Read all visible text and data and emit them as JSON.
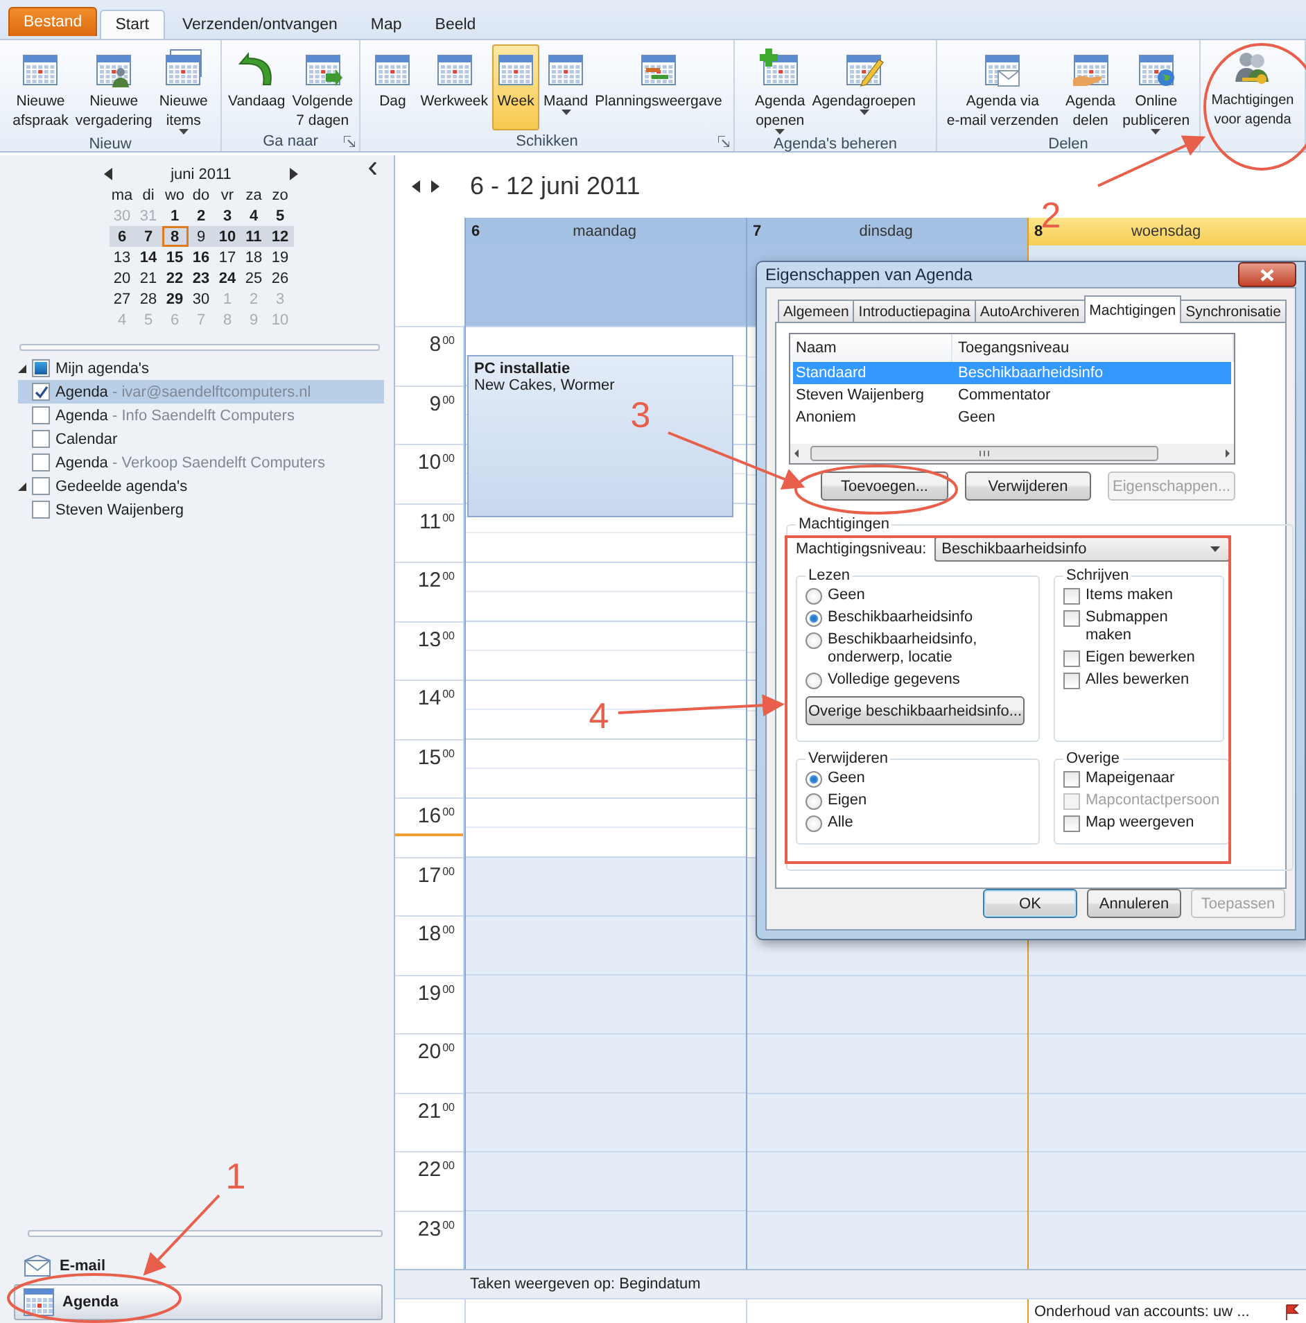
{
  "app_tabs": [
    {
      "label": "Bestand",
      "kind": "file",
      "selected": false
    },
    {
      "label": "Start",
      "kind": "tab",
      "selected": true
    },
    {
      "label": "Verzenden/ontvangen",
      "kind": "tab",
      "selected": false
    },
    {
      "label": "Map",
      "kind": "tab",
      "selected": false
    },
    {
      "label": "Beeld",
      "kind": "tab",
      "selected": false
    }
  ],
  "ribbon": [
    {
      "label": "Nieuw",
      "launcher": false,
      "buttons": [
        {
          "lines": [
            "Nieuwe",
            "afspraak"
          ],
          "dropdown": false,
          "selected": false
        },
        {
          "lines": [
            "Nieuwe",
            "vergadering"
          ],
          "dropdown": false,
          "selected": false
        },
        {
          "lines": [
            "Nieuwe",
            "items"
          ],
          "dropdown": true,
          "selected": false
        }
      ]
    },
    {
      "label": "Ga naar",
      "launcher": true,
      "buttons": [
        {
          "lines": [
            "Vandaag"
          ],
          "dropdown": false,
          "selected": false
        },
        {
          "lines": [
            "Volgende",
            "7 dagen"
          ],
          "dropdown": false,
          "selected": false
        }
      ]
    },
    {
      "label": "Schikken",
      "launcher": true,
      "buttons": [
        {
          "lines": [
            "Dag"
          ],
          "dropdown": false,
          "selected": false
        },
        {
          "lines": [
            "Werkweek"
          ],
          "dropdown": false,
          "selected": false
        },
        {
          "lines": [
            "Week"
          ],
          "dropdown": false,
          "selected": true
        },
        {
          "lines": [
            "Maand"
          ],
          "dropdown": true,
          "selected": false
        },
        {
          "lines": [
            "Planningsweergave"
          ],
          "dropdown": false,
          "selected": false
        }
      ]
    },
    {
      "label": "Agenda's beheren",
      "launcher": false,
      "buttons": [
        {
          "lines": [
            "Agenda",
            "openen"
          ],
          "dropdown": true,
          "selected": false
        },
        {
          "lines": [
            "Agendagroepen"
          ],
          "dropdown": true,
          "selected": false
        }
      ]
    },
    {
      "label": "Delen",
      "launcher": false,
      "buttons": [
        {
          "lines": [
            "Agenda via",
            "e-mail verzenden"
          ],
          "dropdown": false,
          "selected": false
        },
        {
          "lines": [
            "Agenda",
            "delen"
          ],
          "dropdown": false,
          "selected": false
        },
        {
          "lines": [
            "Online",
            "publiceren"
          ],
          "dropdown": true,
          "selected": false
        }
      ]
    },
    {
      "buttons": [
        {
          "lines": [
            "Machtigingen",
            "voor agenda"
          ],
          "dropdown": false,
          "selected": false
        }
      ]
    }
  ],
  "mini_calendar": {
    "month": "juni 2011",
    "weekdays": [
      "ma",
      "di",
      "wo",
      "do",
      "vr",
      "za",
      "zo"
    ],
    "weeks": [
      {
        "selected": false,
        "days": [
          {
            "d": "30",
            "muted": true,
            "bold": false,
            "today": false
          },
          {
            "d": "31",
            "muted": true,
            "bold": false,
            "today": false
          },
          {
            "d": "1",
            "muted": false,
            "bold": true,
            "today": false
          },
          {
            "d": "2",
            "muted": false,
            "bold": true,
            "today": false
          },
          {
            "d": "3",
            "muted": false,
            "bold": true,
            "today": false
          },
          {
            "d": "4",
            "muted": false,
            "bold": true,
            "today": false
          },
          {
            "d": "5",
            "muted": false,
            "bold": true,
            "today": false
          }
        ]
      },
      {
        "selected": true,
        "days": [
          {
            "d": "6",
            "muted": false,
            "bold": true,
            "today": false
          },
          {
            "d": "7",
            "muted": false,
            "bold": true,
            "today": false
          },
          {
            "d": "8",
            "muted": false,
            "bold": true,
            "today": true
          },
          {
            "d": "9",
            "muted": false,
            "bold": false,
            "today": false
          },
          {
            "d": "10",
            "muted": false,
            "bold": true,
            "today": false
          },
          {
            "d": "11",
            "muted": false,
            "bold": true,
            "today": false
          },
          {
            "d": "12",
            "muted": false,
            "bold": true,
            "today": false
          }
        ]
      },
      {
        "selected": false,
        "days": [
          {
            "d": "13",
            "muted": false,
            "bold": false,
            "today": false
          },
          {
            "d": "14",
            "muted": false,
            "bold": true,
            "today": false
          },
          {
            "d": "15",
            "muted": false,
            "bold": true,
            "today": false
          },
          {
            "d": "16",
            "muted": false,
            "bold": true,
            "today": false
          },
          {
            "d": "17",
            "muted": false,
            "bold": false,
            "today": false
          },
          {
            "d": "18",
            "muted": false,
            "bold": false,
            "today": false
          },
          {
            "d": "19",
            "muted": false,
            "bold": false,
            "today": false
          }
        ]
      },
      {
        "selected": false,
        "days": [
          {
            "d": "20",
            "muted": false,
            "bold": false,
            "today": false
          },
          {
            "d": "21",
            "muted": false,
            "bold": false,
            "today": false
          },
          {
            "d": "22",
            "muted": false,
            "bold": true,
            "today": false
          },
          {
            "d": "23",
            "muted": false,
            "bold": true,
            "today": false
          },
          {
            "d": "24",
            "muted": false,
            "bold": true,
            "today": false
          },
          {
            "d": "25",
            "muted": false,
            "bold": false,
            "today": false
          },
          {
            "d": "26",
            "muted": false,
            "bold": false,
            "today": false
          }
        ]
      },
      {
        "selected": false,
        "days": [
          {
            "d": "27",
            "muted": false,
            "bold": false,
            "today": false
          },
          {
            "d": "28",
            "muted": false,
            "bold": false,
            "today": false
          },
          {
            "d": "29",
            "muted": false,
            "bold": true,
            "today": false
          },
          {
            "d": "30",
            "muted": false,
            "bold": false,
            "today": false
          },
          {
            "d": "1",
            "muted": true,
            "bold": false,
            "today": false
          },
          {
            "d": "2",
            "muted": true,
            "bold": false,
            "today": false
          },
          {
            "d": "3",
            "muted": true,
            "bold": false,
            "today": false
          }
        ]
      },
      {
        "selected": false,
        "days": [
          {
            "d": "4",
            "muted": true,
            "bold": false,
            "today": false
          },
          {
            "d": "5",
            "muted": true,
            "bold": false,
            "today": false
          },
          {
            "d": "6",
            "muted": true,
            "bold": false,
            "today": false
          },
          {
            "d": "7",
            "muted": true,
            "bold": false,
            "today": false
          },
          {
            "d": "8",
            "muted": true,
            "bold": false,
            "today": false
          },
          {
            "d": "9",
            "muted": true,
            "bold": false,
            "today": false
          },
          {
            "d": "10",
            "muted": true,
            "bold": false,
            "today": false
          }
        ]
      }
    ]
  },
  "calendar_tree": [
    {
      "label": "Mijn agenda's",
      "checked": false,
      "partial": true,
      "expanded": true,
      "selected": false,
      "children": [
        {
          "label": "Agenda",
          "detail": "- ivar@saendelftcomputers.nl",
          "checked": true,
          "partial": false,
          "selected": true
        },
        {
          "label": "Agenda",
          "detail": "- Info Saendelft Computers",
          "checked": false,
          "partial": false,
          "selected": false
        },
        {
          "label": "Calendar",
          "checked": false,
          "partial": false,
          "selected": false
        },
        {
          "label": "Agenda",
          "detail": "- Verkoop Saendelft Computers",
          "checked": false,
          "partial": false,
          "selected": false
        }
      ]
    },
    {
      "label": "Gedeelde agenda's",
      "checked": false,
      "partial": false,
      "expanded": true,
      "selected": false,
      "children": [
        {
          "label": "Steven Waijenberg",
          "checked": false,
          "partial": false,
          "selected": false
        }
      ]
    }
  ],
  "nav_buttons": [
    {
      "label": "E-mail",
      "kind": "mail",
      "selected": false
    },
    {
      "label": "Agenda",
      "kind": "calendar",
      "selected": true
    }
  ],
  "calendar": {
    "date_range": "6 - 12 juni 2011",
    "days": [
      {
        "number": "6",
        "name": "maandag",
        "today": false,
        "events": [
          {
            "title": "PC installatie",
            "location": "New Cakes, Wormer"
          }
        ]
      },
      {
        "number": "7",
        "name": "dinsdag",
        "today": false
      },
      {
        "number": "8",
        "name": "woensdag",
        "today": true,
        "tasks": [
          {
            "title": "Onderhoud van accounts: uw ..."
          }
        ]
      }
    ],
    "hours": [
      {
        "label": "8$^{00}$",
        "work": true,
        "current": false
      },
      {
        "label": "9$^{00}$",
        "work": true,
        "current": false
      },
      {
        "label": "10$^{00}$",
        "work": true,
        "current": false
      },
      {
        "label": "11$^{00}$",
        "work": true,
        "current": false
      },
      {
        "label": "12$^{00}$",
        "work": true,
        "current": false
      },
      {
        "label": "13$^{00}$",
        "work": true,
        "current": false
      },
      {
        "label": "14$^{00}$",
        "work": true,
        "current": false
      },
      {
        "label": "15$^{00}$",
        "work": true,
        "current": false
      },
      {
        "label": "16$^{00}$",
        "work": true,
        "current": true
      },
      {
        "label": "17$^{00}$",
        "work": false,
        "current": false
      },
      {
        "label": "18$^{00}$",
        "work": false,
        "current": false
      },
      {
        "label": "19$^{00}$",
        "work": false,
        "current": false
      },
      {
        "label": "20$^{00}$",
        "work": false,
        "current": false
      },
      {
        "label": "21$^{00}$",
        "work": false,
        "current": false
      },
      {
        "label": "22$^{00}$",
        "work": false,
        "current": false
      },
      {
        "label": "23$^{00}$",
        "work": false,
        "current": false
      }
    ],
    "tasks_bar": "Taken weergeven op: Begindatum"
  },
  "dialog": {
    "title": "Eigenschappen van Agenda",
    "tabs": [
      {
        "label": "Algemeen",
        "selected": false
      },
      {
        "label": "Introductiepagina",
        "selected": false
      },
      {
        "label": "AutoArchiveren",
        "selected": false
      },
      {
        "label": "Machtigingen",
        "selected": true
      },
      {
        "label": "Synchronisatie",
        "selected": false
      }
    ],
    "columns": [
      "Naam",
      "Toegangsniveau"
    ],
    "rows": [
      {
        "name": "Standaard",
        "level": "Beschikbaarheidsinfo",
        "selected": true
      },
      {
        "name": "Steven Waijenberg",
        "level": "Commentator",
        "selected": false
      },
      {
        "name": "Anoniem",
        "level": "Geen",
        "selected": false
      }
    ],
    "list_buttons": [
      {
        "label": "Toevoegen...",
        "disabled": false
      },
      {
        "label": "Verwijderen",
        "disabled": false
      },
      {
        "label": "Eigenschappen...",
        "disabled": true
      }
    ],
    "permissions_label": "Machtigingen",
    "permission_level_label": "Machtigingsniveau:",
    "permission_level": "Beschikbaarheidsinfo",
    "groups": [
      {
        "title": "Lezen",
        "kind": "radio",
        "options": [
          {
            "label": "Geen",
            "selected": false,
            "disabled": false
          },
          {
            "label": "Beschikbaarheidsinfo",
            "selected": true,
            "disabled": false
          },
          {
            "label": "Beschikbaarheidsinfo, onderwerp, locatie",
            "selected": false,
            "disabled": false
          },
          {
            "label": "Volledige gegevens",
            "selected": false,
            "disabled": false
          }
        ],
        "button": "Overige beschikbaarheidsinfo..."
      },
      {
        "title": "Schrijven",
        "kind": "check",
        "options": [
          {
            "label": "Items maken",
            "selected": false,
            "disabled": false
          },
          {
            "label": "Submappen maken",
            "selected": false,
            "disabled": false
          },
          {
            "label": "Eigen bewerken",
            "selected": false,
            "disabled": false
          },
          {
            "label": "Alles bewerken",
            "selected": false,
            "disabled": false
          }
        ]
      },
      {
        "title": "Verwijderen",
        "kind": "radio",
        "options": [
          {
            "label": "Geen",
            "selected": true,
            "disabled": false
          },
          {
            "label": "Eigen",
            "selected": false,
            "disabled": false
          },
          {
            "label": "Alle",
            "selected": false,
            "disabled": false
          }
        ]
      },
      {
        "title": "Overige",
        "kind": "check",
        "options": [
          {
            "label": "Mapeigenaar",
            "selected": false,
            "disabled": false
          },
          {
            "label": "Mapcontactpersoon",
            "selected": false,
            "disabled": true
          },
          {
            "label": "Map weergeven",
            "selected": false,
            "disabled": false
          }
        ]
      }
    ],
    "footer_buttons": [
      {
        "label": "OK",
        "disabled": false,
        "default": true
      },
      {
        "label": "Annuleren",
        "disabled": false,
        "default": false
      },
      {
        "label": "Toepassen",
        "disabled": true,
        "default": false
      }
    ]
  },
  "annotations": [
    {
      "label": "1"
    },
    {
      "label": "2"
    },
    {
      "label": "3"
    },
    {
      "label": "4"
    }
  ]
}
